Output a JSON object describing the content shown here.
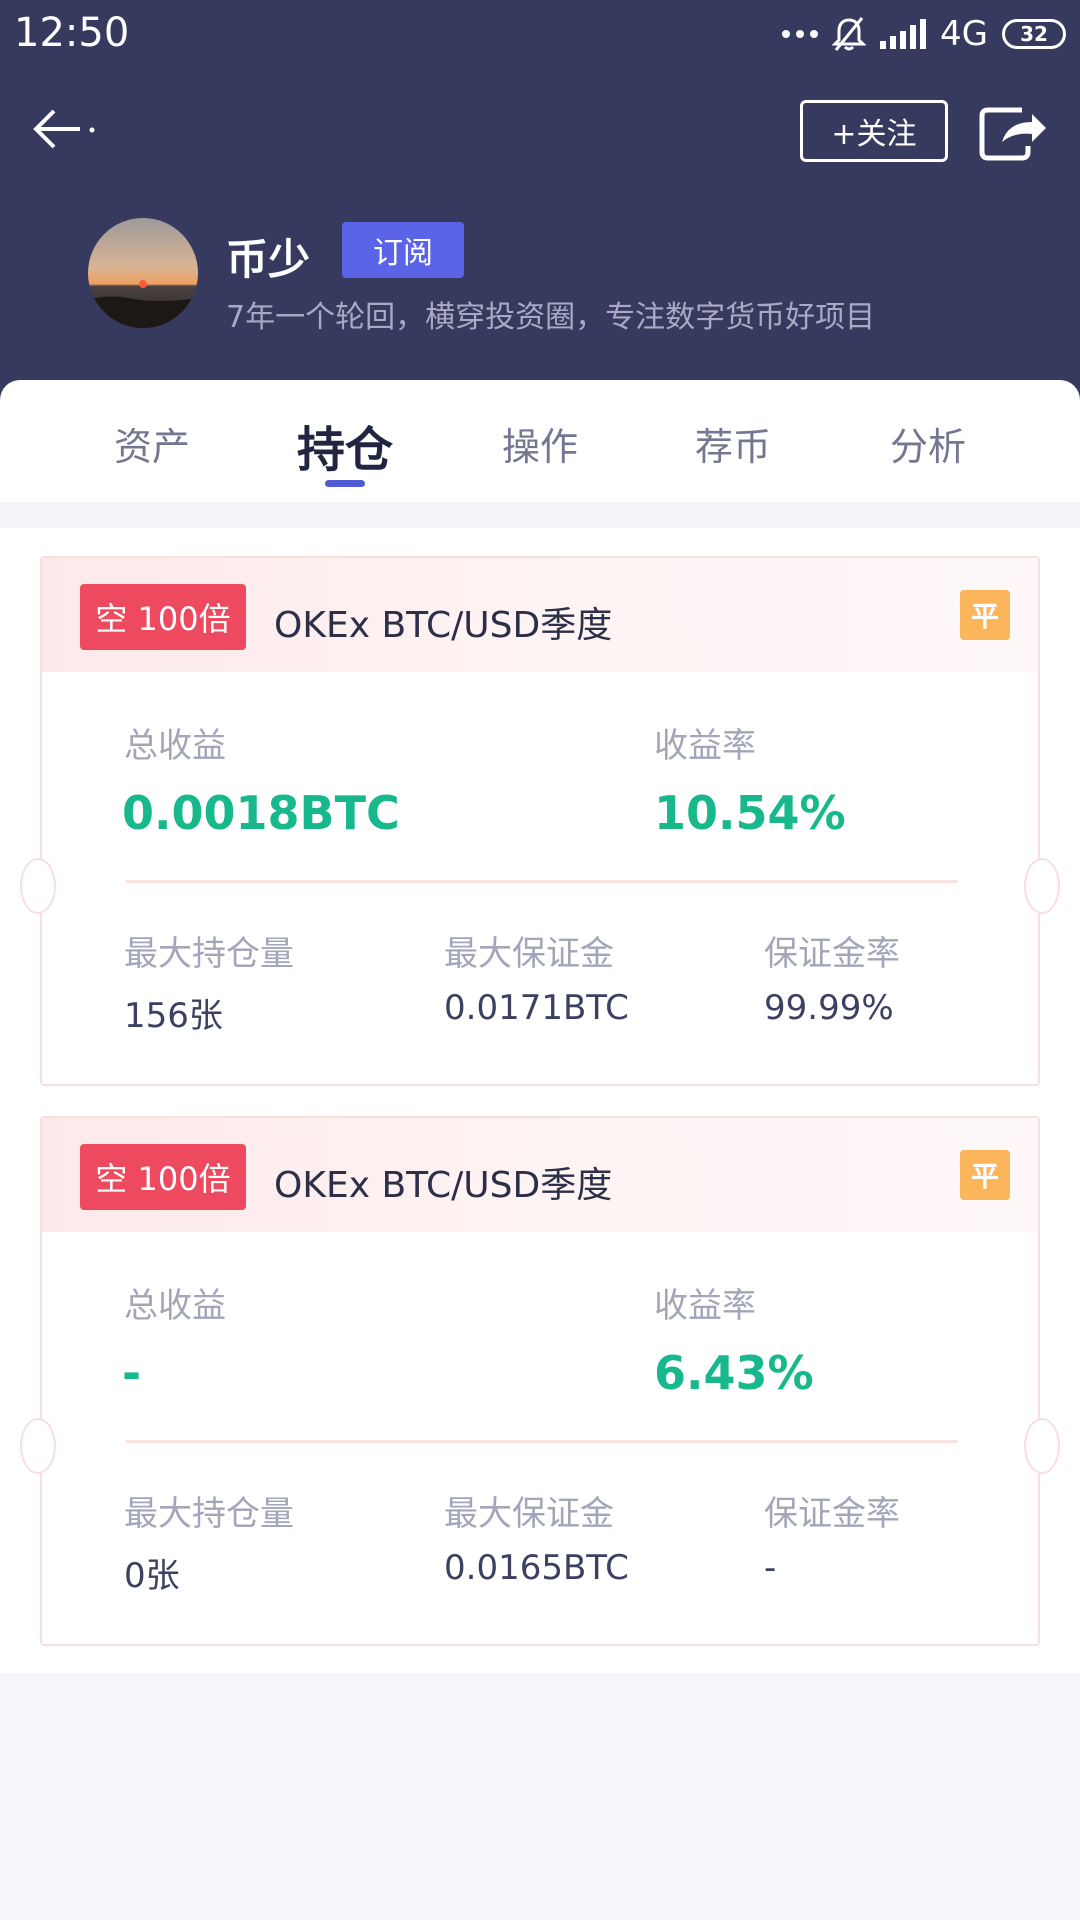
{
  "status_bar": {
    "time": "12:50",
    "network": "4G",
    "battery": "32"
  },
  "header": {
    "follow_label": "+关注",
    "user_name": "币少",
    "subscribe_label": "订阅",
    "bio": "7年一个轮回，横穿投资圈，专注数字货币好项目"
  },
  "tabs": [
    {
      "label": "资产",
      "active": false
    },
    {
      "label": "持仓",
      "active": true
    },
    {
      "label": "操作",
      "active": false
    },
    {
      "label": "荐币",
      "active": false
    },
    {
      "label": "分析",
      "active": false
    }
  ],
  "positions": [
    {
      "side_badge": "空 100倍",
      "title": "OKEx BTC/USD季度",
      "close_label": "平",
      "total_profit_label": "总收益",
      "total_profit": "0.0018BTC",
      "profit_rate_label": "收益率",
      "profit_rate": "10.54%",
      "max_position_label": "最大持仓量",
      "max_position": "156张",
      "max_margin_label": "最大保证金",
      "max_margin": "0.0171BTC",
      "margin_rate_label": "保证金率",
      "margin_rate": "99.99%"
    },
    {
      "side_badge": "空 100倍",
      "title": "OKEx BTC/USD季度",
      "close_label": "平",
      "total_profit_label": "总收益",
      "total_profit": "-",
      "profit_rate_label": "收益率",
      "profit_rate": "6.43%",
      "max_position_label": "最大持仓量",
      "max_position": "0张",
      "max_margin_label": "最大保证金",
      "max_margin": "0.0165BTC",
      "margin_rate_label": "保证金率",
      "margin_rate": "-"
    }
  ],
  "colors": {
    "header_bg": "#363a5e",
    "accent": "#5b63e6",
    "profit_green": "#17b88c",
    "short_red": "#ed4a60",
    "close_orange": "#fbb55a"
  }
}
